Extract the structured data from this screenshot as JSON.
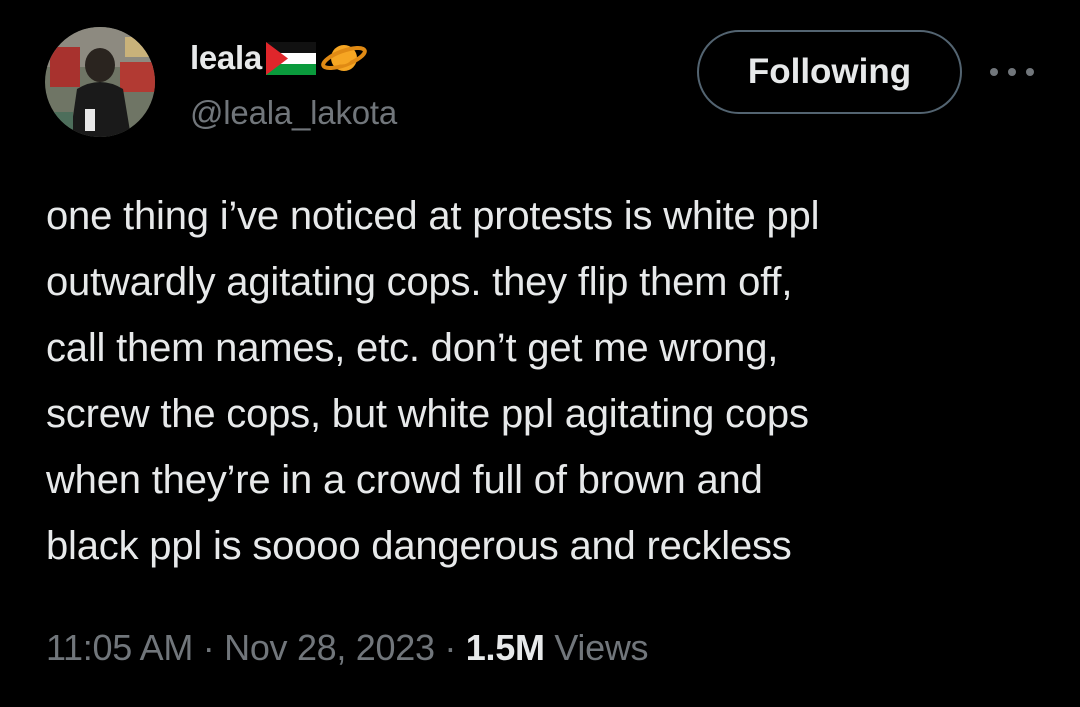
{
  "author": {
    "display_name": "leala",
    "handle": "@leala_lakota",
    "name_emojis": [
      "palestine-flag-icon",
      "ringed-planet-icon"
    ]
  },
  "actions": {
    "follow_label": "Following",
    "more_icon": "more-dots-icon"
  },
  "tweet": {
    "text": "one thing i’ve noticed at protests is white ppl\noutwardly agitating cops. they flip them off,\ncall them names, etc. don’t get me wrong,\nscrew the cops, but white ppl agitating cops\nwhen they’re in a crowd full of brown and\nblack ppl is soooo dangerous and reckless"
  },
  "meta": {
    "time": "11:05 AM",
    "separator": " · ",
    "date": "Nov 28, 2023",
    "views_count": "1.5M",
    "views_label": "Views"
  },
  "colors": {
    "background": "#000000",
    "primary_text": "#e7e9ea",
    "secondary_text": "#71767b",
    "button_border": "#536471"
  }
}
